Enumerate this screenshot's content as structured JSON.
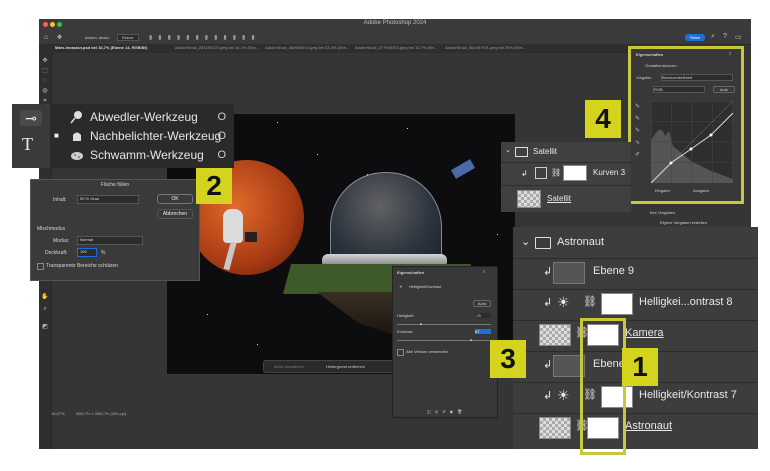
{
  "app": {
    "title": "Adobe Photoshop 2024"
  },
  "options_bar": {
    "items": [
      "Autom. ausw.:",
      "Ebene",
      "Teilen"
    ]
  },
  "tabs": [
    {
      "label": "Mars-Invasion.psd bei 16,7% (Ebene 14, RGB/8#)",
      "active": true
    },
    {
      "label": "AdobeStock_283191020.jpeg bei 16,7% (Ebe...",
      "active": false
    },
    {
      "label": "AdobeStock_368694913.jpeg bei 33,3% (Ebe...",
      "active": false
    },
    {
      "label": "AdobeStock_477949303.jpeg bei 16,7% (Eb...",
      "active": false
    },
    {
      "label": "AdobeStock_551987991.jpeg bei 25% (Ebe...",
      "active": false
    }
  ],
  "status": {
    "zoom": "16,67%",
    "doc": "5000 Px x 3951 Px (300 ppi)"
  },
  "context_bar": {
    "btn1": "Motiv auswählen",
    "btn2": "Hintergrund entfernen"
  },
  "tool_flyout": {
    "items": [
      {
        "label": "Abwedler-Werkzeug",
        "key": "O",
        "icon": "dodge-icon"
      },
      {
        "label": "Nachbelichter-Werkzeug",
        "key": "O",
        "icon": "burn-icon",
        "active": true
      },
      {
        "label": "Schwamm-Werkzeug",
        "key": "O",
        "icon": "sponge-icon"
      }
    ]
  },
  "fill_dialog": {
    "title": "Fläche füllen",
    "inhalt_label": "Inhalt:",
    "inhalt_value": "50 % Grau",
    "ok": "OK",
    "cancel": "Abbrechen",
    "section": "Mischmodus",
    "modus_label": "Modus:",
    "modus_value": "Normal",
    "deckkraft_label": "Deckkraft:",
    "deckkraft_value": "100",
    "percent": "%",
    "preserve": "Transparente Bereiche schützen"
  },
  "curves_panel": {
    "header": "Eigenschaften",
    "subtitle": "Gradationskurven",
    "vorgabe_label": "Vorgabe:",
    "vorgabe_value": "Benutzerdefiniert",
    "channel": "RGB",
    "auto": "Auto",
    "eingabe": "Eingabe:",
    "ausgabe": "Ausgabe:",
    "below1": "Ihre Vorgaben",
    "below2": "Eigene Vorgaben erstellen"
  },
  "bc_panel": {
    "header": "Eigenschaften",
    "subtitle": "Helligkeit/Kontrast",
    "auto": "Auto",
    "helligkeit_label": "Helligkeit:",
    "helligkeit_value": "-78",
    "kontrast_label": "Kontrast:",
    "kontrast_value": "67",
    "legacy": "Alte Version verwenden"
  },
  "satellite_panel": {
    "group": "Satellit",
    "layer1": "Kurven 3",
    "layer2": "Satellit"
  },
  "astronaut_panel": {
    "group": "Astronaut",
    "rows": [
      "Ebene 9",
      "Helligkei...ontrast 8",
      "Kamera",
      "Ebene",
      "Helligkeit/Kontrast 7",
      "Astronaut"
    ]
  },
  "callouts": {
    "c1": "1",
    "c2": "2",
    "c3": "3",
    "c4": "4"
  },
  "colors": {
    "highlight": "#c8c83a",
    "callout": "#d4d41e",
    "accent": "#1e6fd9"
  }
}
